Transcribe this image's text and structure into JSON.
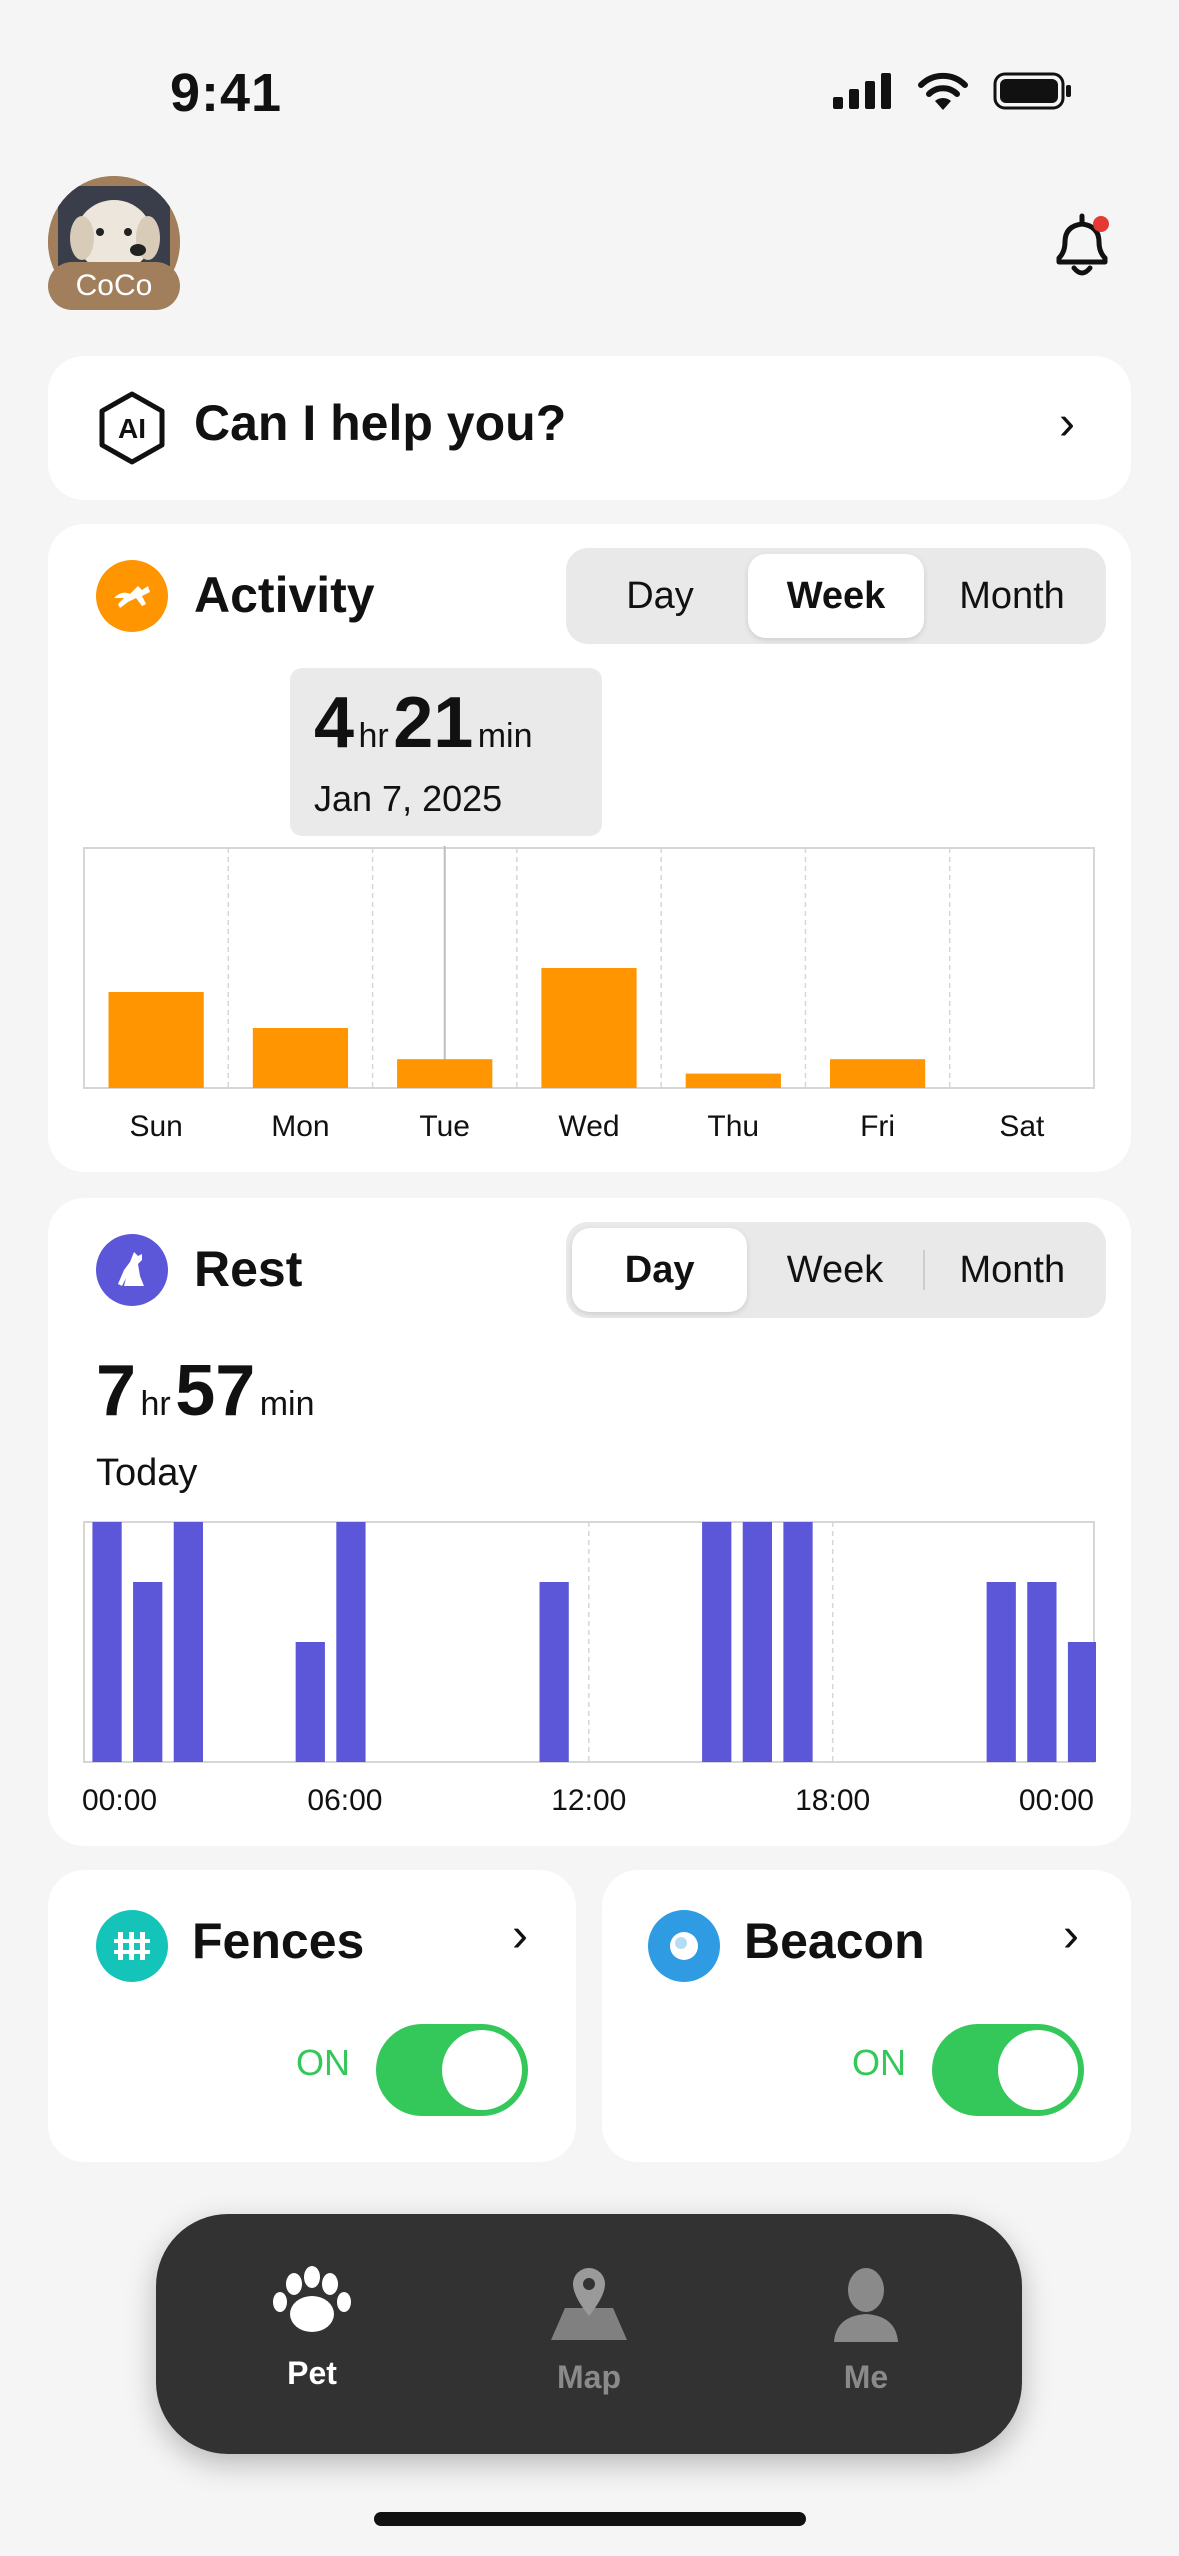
{
  "status_bar": {
    "time": "9:41"
  },
  "pet": {
    "name": "CoCo"
  },
  "assistant": {
    "icon_text": "AI",
    "label": "Can I help you?"
  },
  "activity": {
    "title": "Activity",
    "tabs": [
      "Day",
      "Week",
      "Month"
    ],
    "active_tab": "Week",
    "tooltip": {
      "hours": "4",
      "hr_unit": "hr",
      "minutes": "21",
      "min_unit": "min",
      "date": "Jan 7, 2025"
    },
    "accent": "#ff9500",
    "chart_data": {
      "type": "bar",
      "categories": [
        "Sun",
        "Mon",
        "Tue",
        "Wed",
        "Thu",
        "Fri",
        "Sat"
      ],
      "values": [
        0.4,
        0.25,
        0.12,
        0.5,
        0.06,
        0.12,
        0
      ],
      "highlight": "Tue",
      "grid": true
    }
  },
  "rest": {
    "title": "Rest",
    "tabs": [
      "Day",
      "Week",
      "Month"
    ],
    "active_tab": "Day",
    "hours": "7",
    "hr_unit": "hr",
    "minutes": "57",
    "min_unit": "min",
    "period": "Today",
    "accent": "#5b57d8",
    "chart_data": {
      "type": "bar",
      "x_ticks": [
        "00:00",
        "06:00",
        "12:00",
        "18:00",
        "00:00"
      ],
      "values": [
        1,
        0.75,
        1,
        0,
        0,
        0.5,
        1,
        0,
        0,
        0,
        0,
        0.75,
        0,
        0,
        0,
        1,
        1,
        1,
        0,
        0,
        0,
        0,
        0.75,
        0.75,
        0.5
      ],
      "grid": true
    }
  },
  "fences": {
    "title": "Fences",
    "state": "ON",
    "accent": "#14c4b8"
  },
  "beacon": {
    "title": "Beacon",
    "state": "ON",
    "accent": "#2f9be3"
  },
  "tabbar": {
    "items": [
      {
        "label": "Pet",
        "icon": "paw-icon",
        "active": true
      },
      {
        "label": "Map",
        "icon": "map-icon",
        "active": false
      },
      {
        "label": "Me",
        "icon": "person-icon",
        "active": false
      }
    ]
  }
}
